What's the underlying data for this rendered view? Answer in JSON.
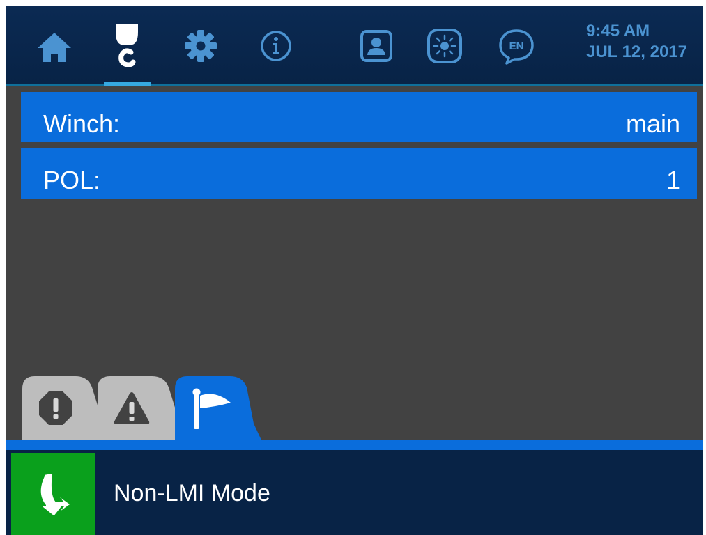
{
  "header": {
    "nav": [
      {
        "name": "home",
        "icon": "home-icon"
      },
      {
        "name": "hook",
        "icon": "crane-hook-icon",
        "active": true
      },
      {
        "name": "settings",
        "icon": "gear-icon"
      },
      {
        "name": "info",
        "icon": "info-icon"
      },
      {
        "name": "operator",
        "icon": "operator-profile-icon"
      },
      {
        "name": "brightness",
        "icon": "brightness-icon"
      },
      {
        "name": "language",
        "icon": "language-en-icon",
        "text": "EN"
      }
    ],
    "time": "9:45 AM",
    "date": "JUL 12, 2017"
  },
  "params": [
    {
      "label": "Winch:",
      "value": "main"
    },
    {
      "label": "POL:",
      "value": "1"
    }
  ],
  "alert_tabs": [
    {
      "name": "errors",
      "icon": "error-octagon-icon",
      "active": false
    },
    {
      "name": "warnings",
      "icon": "warning-triangle-icon",
      "active": false
    },
    {
      "name": "flags",
      "icon": "flag-icon",
      "active": true
    }
  ],
  "status": {
    "mode_icon": "bypass-arrow-icon",
    "mode_label": "Non-LMI Mode"
  },
  "colors": {
    "topbar": "#0b2a53",
    "accent_blue": "#0a6ddc",
    "active_indicator": "#36a9e1",
    "icon_blue": "#4b93d1",
    "background": "#424242",
    "statusbar": "#082346",
    "mode_green": "#0aa01c",
    "inactive_tab": "#bdbdbd"
  }
}
